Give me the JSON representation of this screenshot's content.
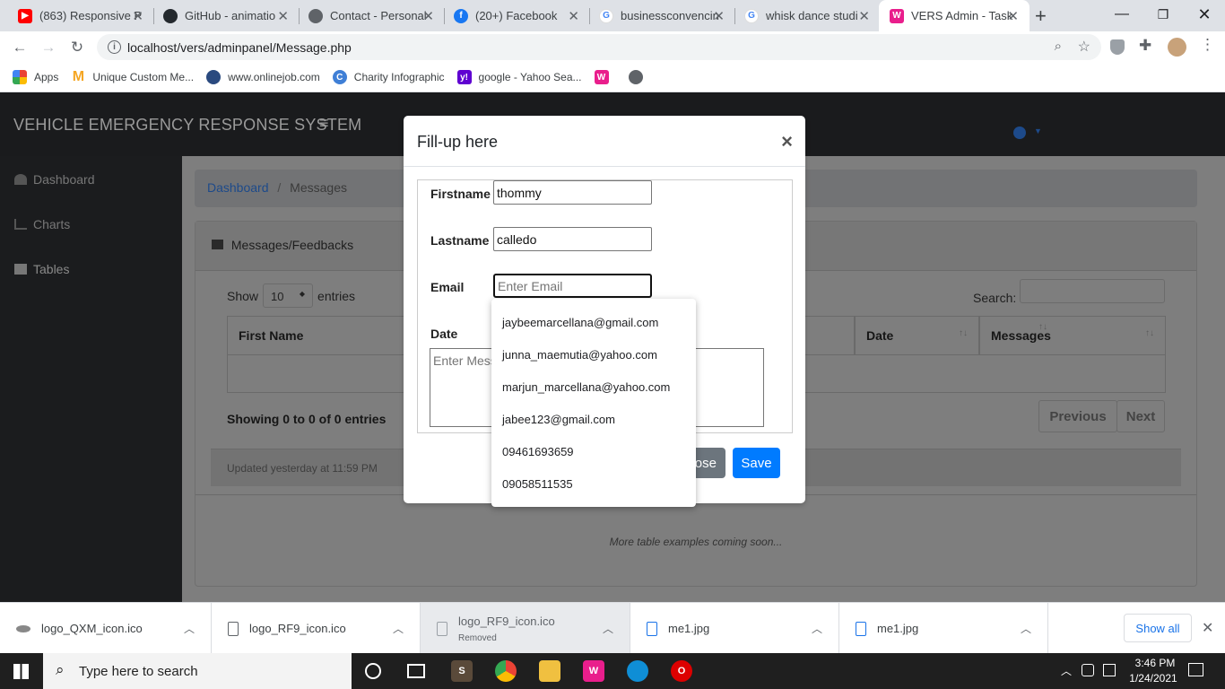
{
  "browser": {
    "tabs": [
      {
        "title": "(863) Responsive P",
        "icon": "youtube-icon",
        "color": "#ff0000"
      },
      {
        "title": "GitHub - animatio",
        "icon": "github-icon",
        "color": "#24292e"
      },
      {
        "title": "Contact - Personal",
        "icon": "globe-icon",
        "color": "#5f6368"
      },
      {
        "title": "(20+) Facebook",
        "icon": "facebook-icon",
        "color": "#1877f2"
      },
      {
        "title": "businessconvencin",
        "icon": "google-icon",
        "color": "#4285f4"
      },
      {
        "title": "whisk dance studi",
        "icon": "google-icon",
        "color": "#4285f4"
      },
      {
        "title": "VERS Admin - Task",
        "icon": "vers-icon",
        "color": "#e91e8c"
      }
    ],
    "url": "localhost/vers/adminpanel/Message.php",
    "bookmarks": [
      {
        "label": "Apps",
        "icon": "apps-grid-icon"
      },
      {
        "label": "Unique Custom Me...",
        "icon": "m-logo-icon"
      },
      {
        "label": "www.onlinejob.com",
        "icon": "onlinejob-icon"
      },
      {
        "label": "Charity Infographic",
        "icon": "canva-icon"
      },
      {
        "label": "google - Yahoo Sea...",
        "icon": "yahoo-icon"
      }
    ]
  },
  "app": {
    "brand": "VEHICLE EMERGENCY RESPONSE SYSTEM",
    "sidebar": [
      {
        "label": "Dashboard",
        "icon": "dashboard-icon"
      },
      {
        "label": "Charts",
        "icon": "chart-icon"
      },
      {
        "label": "Tables",
        "icon": "table-icon"
      }
    ],
    "breadcrumb": {
      "home": "Dashboard",
      "sep": "/",
      "current": "Messages"
    },
    "card_title": "Messages/Feedbacks",
    "show_label": "Show",
    "entries_value": "10",
    "entries_label": "entries",
    "search_label": "Search:",
    "columns": [
      "First Name",
      "Date",
      "Messages"
    ],
    "showing": "Showing 0 to 0 of 0 entries",
    "prev": "Previous",
    "next": "Next",
    "updated": "Updated yesterday at 11:59 PM",
    "footer_note": "More table examples coming soon..."
  },
  "modal": {
    "title": "Fill-up here",
    "close_glyph": "×",
    "fields": {
      "firstname_label": "Firstname",
      "firstname_value": "thommy",
      "lastname_label": "Lastname",
      "lastname_value": "calledo",
      "email_label": "Email",
      "email_placeholder": "Enter Email",
      "date_label": "Date",
      "message_placeholder": "Enter Message"
    },
    "close_button": "Close",
    "save_button": "Save",
    "autocomplete": [
      "jaybeemarcellana@gmail.com",
      "junna_maemutia@yahoo.com",
      "marjun_marcellana@yahoo.com",
      "jabee123@gmail.com",
      "09461693659",
      "09058511535"
    ]
  },
  "downloads": {
    "items": [
      {
        "name": "logo_QXM_icon.ico",
        "status": ""
      },
      {
        "name": "logo_RF9_icon.ico",
        "status": ""
      },
      {
        "name": "logo_RF9_icon.ico",
        "status": "Removed"
      },
      {
        "name": "me1.jpg",
        "status": ""
      },
      {
        "name": "me1.jpg",
        "status": ""
      }
    ],
    "show_all": "Show all"
  },
  "taskbar": {
    "search_placeholder": "Type here to search",
    "time": "3:46 PM",
    "date": "1/24/2021"
  },
  "colors": {
    "primary": "#007bff",
    "secondary": "#6c757d",
    "link": "#2a5db0"
  }
}
